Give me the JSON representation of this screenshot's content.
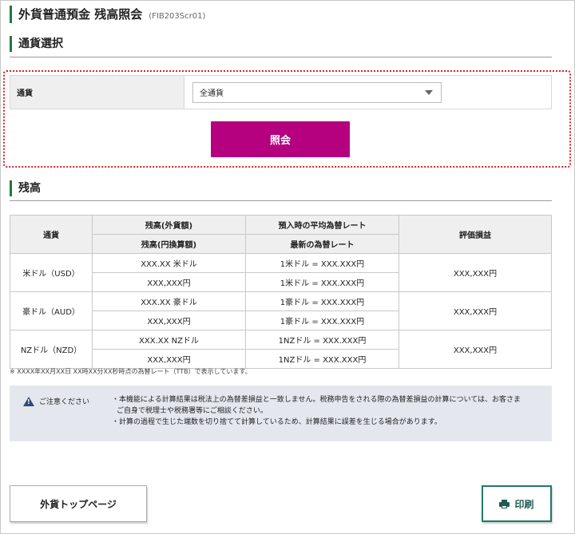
{
  "page": {
    "title": "外貨普通預金 残高照会",
    "screen_code": "(FIB203Scr01)"
  },
  "currency_section": {
    "heading": "通貨選択",
    "label": "通貨",
    "select_value": "全通貨",
    "inquiry_label": "照会"
  },
  "balance_section": {
    "heading": "残高",
    "headers": {
      "currency": "通貨",
      "amount_foreign": "残高(外貨額)",
      "amount_yen": "残高(円換算額)",
      "rate_avg": "預入時の平均為替レート",
      "rate_latest": "最新の為替レート",
      "valuation": "評価損益"
    },
    "rows": [
      {
        "currency": "米ドル（USD）",
        "foreign": "XXX.XX 米ドル",
        "yen": "XXX,XXX円",
        "avg_rate": "1米ドル = XXX.XXX円",
        "latest_rate": "1米ドル = XXX.XXX円",
        "valuation": "XXX,XXX円"
      },
      {
        "currency": "豪ドル（AUD）",
        "foreign": "XXX.XX 豪ドル",
        "yen": "XXX,XXX円",
        "avg_rate": "1豪ドル = XXX.XXX円",
        "latest_rate": "1豪ドル = XXX.XXX円",
        "valuation": "XXX,XXX円"
      },
      {
        "currency": "NZドル（NZD）",
        "foreign": "XXX.XX NZドル",
        "yen": "XXX,XXX円",
        "avg_rate": "1NZドル = XXX.XXX円",
        "latest_rate": "1NZドル = XXX.XXX円",
        "valuation": "XXX,XXX円"
      }
    ],
    "note": "※ XXXX年XX月XX日 XX時XX分XX秒時点の為替レート（TTB）で表示しています。"
  },
  "caution": {
    "title": "ご注意ください",
    "line1": "・本機能による計算結果は税法上の為替差損益と一致しません。税務申告をされる際の為替差損益の計算については、お客さま",
    "line2": "ご自身で税理士や税務署等にご相談ください。",
    "line3": "・計算の過程で生じた端数を切り捨てて計算しているため、計算結果に誤差を生じる場合があります。"
  },
  "buttons": {
    "top_page": "外貨トップページ",
    "print": "印刷"
  },
  "colors": {
    "accent_green": "#1f7a3f",
    "inquiry_magenta": "#b5007f",
    "highlight_red": "#e02020",
    "caution_bg": "#e4e8ee"
  },
  "icons": {
    "select": "chevron-down-icon",
    "caution": "warning-icon",
    "print": "printer-icon"
  }
}
